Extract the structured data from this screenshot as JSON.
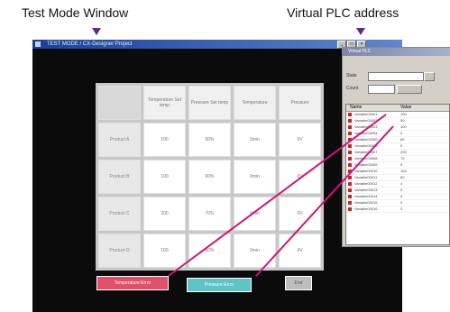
{
  "callouts": {
    "left": "Test Mode Window",
    "right": "Virtual PLC address"
  },
  "window": {
    "title": "TEST MODE / CX-Designer Project",
    "buttons": [
      "_",
      "□",
      "×"
    ]
  },
  "grid": {
    "headers": [
      "Temperature Set temp",
      "Pressure Set temp",
      "Temperature",
      "Pressure"
    ],
    "rows": [
      {
        "label": "Product A",
        "values": [
          "100",
          "50%",
          "0min",
          "0V"
        ]
      },
      {
        "label": "Product B",
        "values": [
          "100",
          "60%",
          "0min",
          "0V"
        ]
      },
      {
        "label": "Product C",
        "values": [
          "200",
          "70%",
          "0min",
          "0V"
        ]
      },
      {
        "label": "Product D",
        "values": [
          "100",
          "60%",
          "0min",
          "4V"
        ]
      }
    ]
  },
  "buttons": {
    "temperature_error": {
      "label": "Temperature Error",
      "color": "#e0506a"
    },
    "pressure_error": {
      "label": "Pressure Error",
      "color": "#5fc4c8"
    },
    "end": {
      "label": "End",
      "color": "#bdbdbd"
    }
  },
  "panel": {
    "title": "Virtual PLC",
    "state_label": "State",
    "count_label": "Count",
    "list_headers": [
      "Name",
      "Value"
    ],
    "list_items": [
      {
        "name": "Variable00001",
        "value": "100"
      },
      {
        "name": "Variable00002",
        "value": "50"
      },
      {
        "name": "Variable00003",
        "value": "100"
      },
      {
        "name": "Variable00004",
        "value": "0"
      },
      {
        "name": "Variable00005",
        "value": "60"
      },
      {
        "name": "Variable00006",
        "value": "0"
      },
      {
        "name": "Variable00007",
        "value": "200"
      },
      {
        "name": "Variable00008",
        "value": "70"
      },
      {
        "name": "Variable00009",
        "value": "0"
      },
      {
        "name": "Variable00010",
        "value": "100"
      },
      {
        "name": "Variable00011",
        "value": "60"
      },
      {
        "name": "Variable00012",
        "value": "4"
      },
      {
        "name": "Variable00013",
        "value": "0"
      },
      {
        "name": "Variable00014",
        "value": "0"
      },
      {
        "name": "Variable00015",
        "value": "0"
      },
      {
        "name": "Variable00016",
        "value": "0"
      }
    ]
  },
  "colors": {
    "connector_lines": "#d0137a",
    "callout_arrow": "#5b2a8c",
    "window_background": "#0b0b0b"
  }
}
